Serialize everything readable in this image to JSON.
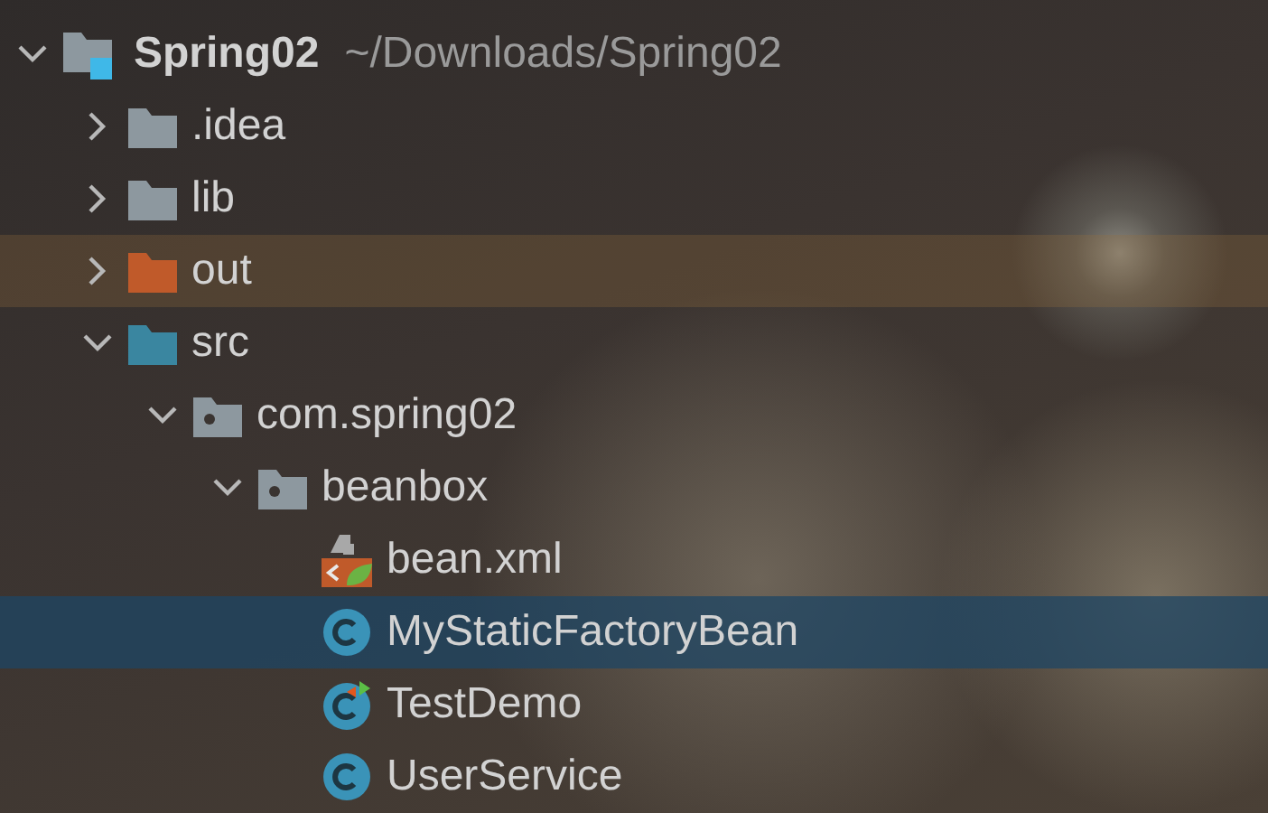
{
  "tree": [
    {
      "label": "Spring02",
      "path": "~/Downloads/Spring02",
      "kind": "project",
      "expanded": true,
      "selected": false,
      "children": [
        {
          "label": ".idea",
          "kind": "folder",
          "expanded": false,
          "selected": false
        },
        {
          "label": "lib",
          "kind": "folder",
          "expanded": false,
          "selected": false
        },
        {
          "label": "out",
          "kind": "excluded-folder",
          "expanded": false,
          "selected": false
        },
        {
          "label": "src",
          "kind": "source-folder",
          "expanded": true,
          "selected": false,
          "children": [
            {
              "label": "com.spring02",
              "kind": "package",
              "expanded": true,
              "selected": false,
              "children": [
                {
                  "label": "beanbox",
                  "kind": "package",
                  "expanded": true,
                  "selected": false,
                  "children": [
                    {
                      "label": "bean.xml",
                      "kind": "xml",
                      "selected": false
                    },
                    {
                      "label": "MyStaticFactoryBean",
                      "kind": "class",
                      "selected": true
                    },
                    {
                      "label": "TestDemo",
                      "kind": "main-class",
                      "selected": false
                    },
                    {
                      "label": "UserService",
                      "kind": "class",
                      "selected": false
                    }
                  ]
                }
              ]
            }
          ]
        }
      ]
    }
  ]
}
